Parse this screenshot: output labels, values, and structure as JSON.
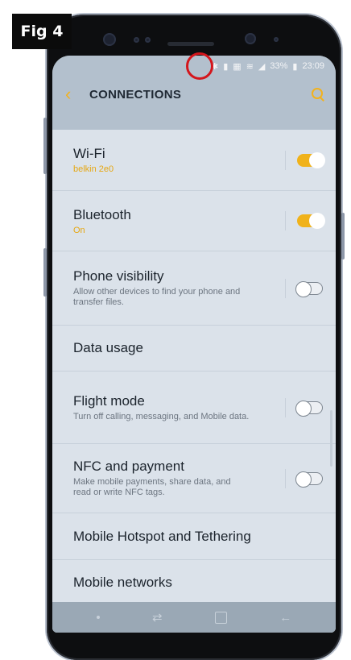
{
  "figure": {
    "label": "Fig 4"
  },
  "status_bar": {
    "battery": "33%",
    "time": "23:09"
  },
  "header": {
    "title": "CONNECTIONS"
  },
  "settings": [
    {
      "title": "Wi-Fi",
      "subtitle": "belkin 2e0",
      "subtitle_style": "accent",
      "toggle": "on"
    },
    {
      "title": "Bluetooth",
      "subtitle": "On",
      "subtitle_style": "accent",
      "toggle": "on"
    },
    {
      "title": "Phone visibility",
      "subtitle": "Allow other devices to find your phone and transfer files.",
      "subtitle_style": "muted",
      "toggle": "off"
    },
    {
      "title": "Data usage"
    },
    {
      "title": "Flight mode",
      "subtitle": "Turn off calling, messaging, and Mobile data.",
      "subtitle_style": "muted",
      "toggle": "off"
    },
    {
      "title": "NFC and payment",
      "subtitle": "Make mobile payments, share data, and read or write NFC tags.",
      "subtitle_style": "muted",
      "toggle": "off"
    },
    {
      "title": "Mobile Hotspot and Tethering"
    },
    {
      "title": "Mobile networks"
    }
  ],
  "colors": {
    "accent": "#f0b21a",
    "highlight_ring": "#d4161c"
  }
}
